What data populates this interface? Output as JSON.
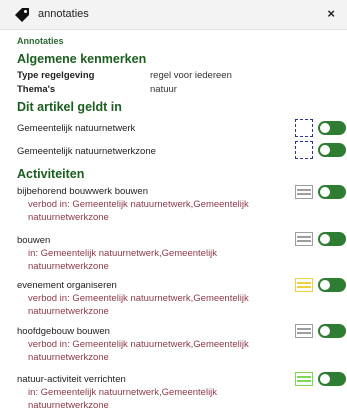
{
  "header": {
    "title": "annotaties",
    "close_label": "×"
  },
  "section_label": "Annotaties",
  "general": {
    "heading": "Algemene kenmerken",
    "props": [
      {
        "key": "Type regelgeving",
        "value": "regel voor iedereen"
      },
      {
        "key": "Thema's",
        "value": "natuur"
      }
    ]
  },
  "applies": {
    "heading": "Dit artikel geldt in",
    "items": [
      {
        "label": "Gemeentelijk natuurnetwerk"
      },
      {
        "label": "Gemeentelijk natuurnetwerkzone"
      }
    ]
  },
  "activities": {
    "heading": "Activiteiten",
    "items": [
      {
        "title": "bijbehorend bouwwerk bouwen",
        "detail": "verbod in: Gemeentelijk natuurnetwerk,Gemeentelijk natuurnetwerkzone",
        "symbol_color": "#9e9e9e"
      },
      {
        "title": "bouwen",
        "detail": "in: Gemeentelijk natuurnetwerk,Gemeentelijk natuurnetwerkzone",
        "symbol_color": "#9e9e9e"
      },
      {
        "title": "evenement organiseren",
        "detail": "verbod in: Gemeentelijk natuurnetwerk,Gemeentelijk natuurnetwerkzone",
        "symbol_color": "#f4d03f"
      },
      {
        "title": "hoofdgebouw bouwen",
        "detail": "verbod in: Gemeentelijk natuurnetwerk,Gemeentelijk natuurnetwerkzone",
        "symbol_color": "#9e9e9e"
      },
      {
        "title": "natuur-activiteit verrichten",
        "detail": "in: Gemeentelijk natuurnetwerk,Gemeentelijk natuurnetwerkzone",
        "symbol_color": "#7ed957"
      }
    ]
  },
  "colors": {
    "accent": "#2e7d32",
    "heading": "#1b5e20",
    "detail_text": "#8c3a4b",
    "zone_border": "#2c3590"
  }
}
